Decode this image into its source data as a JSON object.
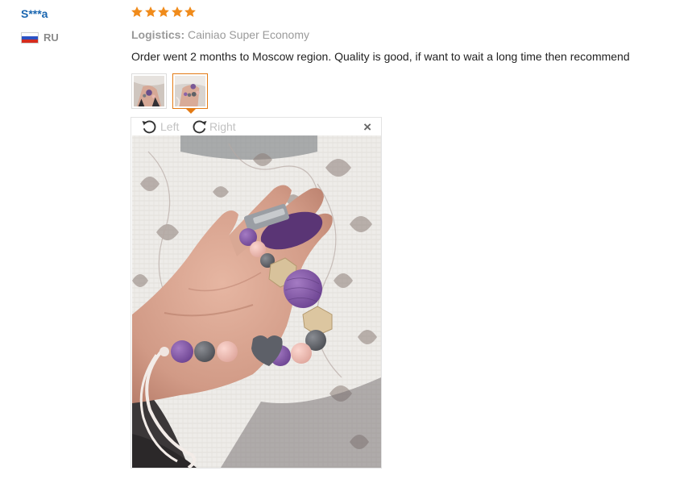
{
  "user": {
    "name": "S***a",
    "country_code": "RU",
    "flag_icon": "russia-flag-icon"
  },
  "feedback": {
    "rating": 5,
    "star_icon": "star-icon",
    "star_color": "#f08b1b",
    "logistics_label": "Logistics:",
    "logistics_value": "Cainiao Super Economy",
    "comment": "Order went 2 months to Moscow region. Quality is good, if want to wait a long time then recommend",
    "thumbnails": [
      {
        "name": "photo-thumbnail-1",
        "active": false
      },
      {
        "name": "photo-thumbnail-2",
        "active": true
      }
    ]
  },
  "viewer": {
    "rotate_left_label": "Left",
    "rotate_right_label": "Right",
    "rotate_left_icon": "rotate-left-icon",
    "rotate_right_icon": "rotate-right-icon",
    "close_icon": "close-icon",
    "close_glyph": "×",
    "image_subject": "silicone bead pacifier clip held in hand"
  },
  "colors": {
    "username": "#1a66b0",
    "accent_border": "#e37a14",
    "muted_text": "#9a9a9a",
    "body_text": "#222222"
  }
}
